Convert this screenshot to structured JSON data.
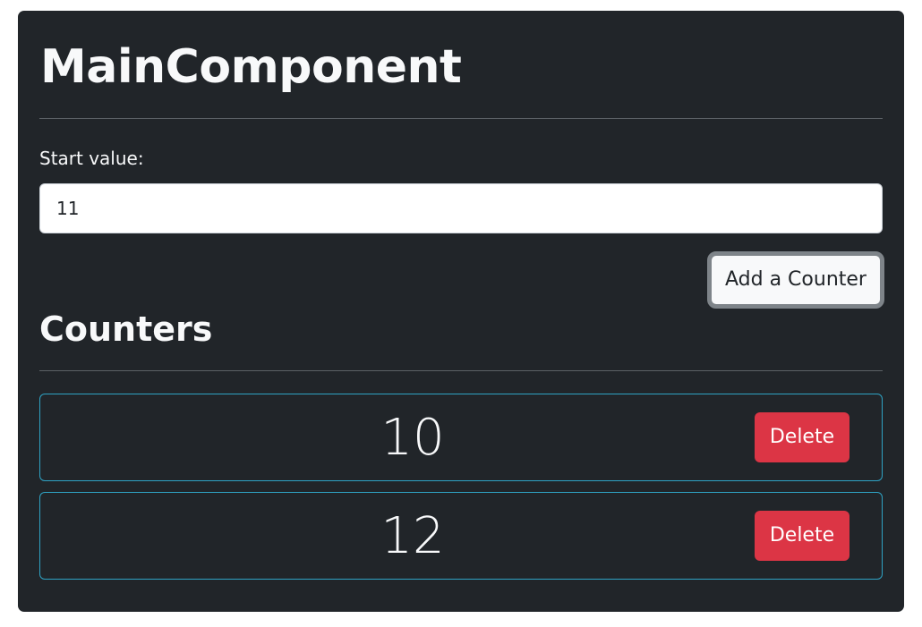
{
  "header": {
    "title": "MainComponent"
  },
  "form": {
    "start_label": "Start value:",
    "start_value": "11",
    "add_button_label": "Add a Counter"
  },
  "counters_section": {
    "title": "Counters",
    "items": [
      {
        "value": "10",
        "delete_label": "Delete"
      },
      {
        "value": "12",
        "delete_label": "Delete"
      }
    ]
  },
  "colors": {
    "panel_bg": "#212529",
    "text": "#f8f9fa",
    "counter_border": "#2fa3c4",
    "delete_button": "#dc3545",
    "add_button_bg": "#f8f9fa",
    "add_button_border": "#7e8489"
  }
}
